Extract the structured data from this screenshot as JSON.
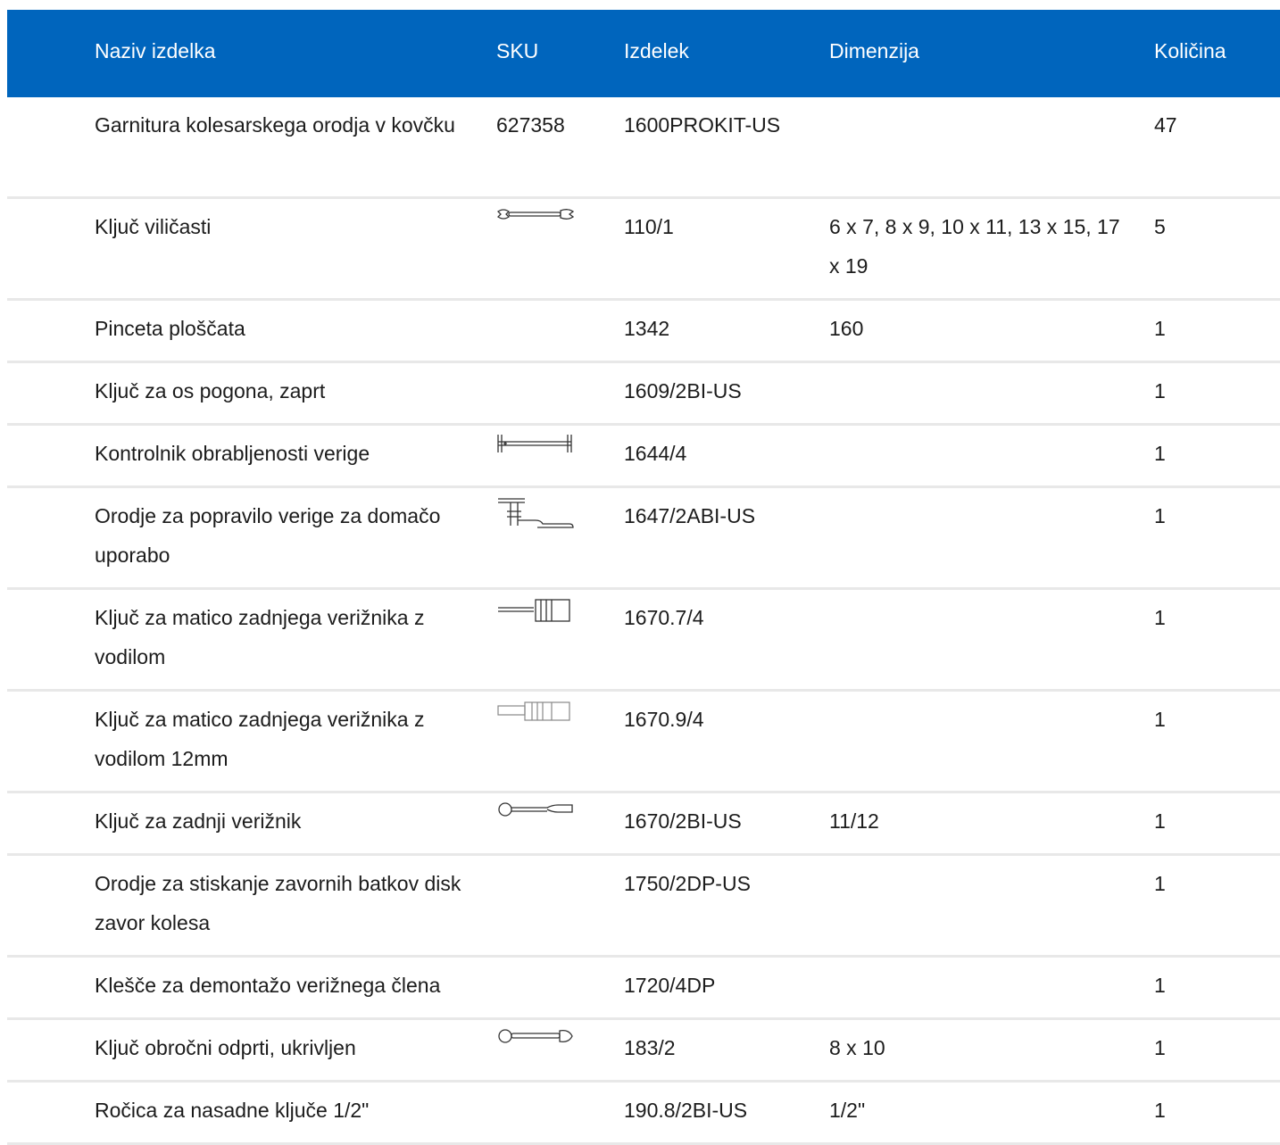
{
  "header": {
    "name": "Naziv izdelka",
    "sku": "SKU",
    "item": "Izdelek",
    "dimension": "Dimenzija",
    "quantity": "Količina"
  },
  "rows": [
    {
      "name": "Garnitura kolesarskega orodja v kovčku",
      "sku": "627358",
      "item": "1600PROKIT-US",
      "dimension": "",
      "quantity": "47",
      "icon": ""
    },
    {
      "name": "Ključ viličasti",
      "sku": "",
      "item": "110/1",
      "dimension": "6 x 7, 8 x 9, 10 x 11, 13 x 15, 17 x 19",
      "quantity": "5",
      "icon": "open-end-wrench-icon"
    },
    {
      "name": "Pinceta ploščata",
      "sku": "",
      "item": "1342",
      "dimension": "160",
      "quantity": "1",
      "icon": ""
    },
    {
      "name": "Ključ za os pogona, zaprt",
      "sku": "",
      "item": "1609/2BI-US",
      "dimension": "",
      "quantity": "1",
      "icon": ""
    },
    {
      "name": "Kontrolnik obrabljenosti verige",
      "sku": "",
      "item": "1644/4",
      "dimension": "",
      "quantity": "1",
      "icon": "chain-wear-gauge-icon"
    },
    {
      "name": "Orodje za popravilo verige za domačo uporabo",
      "sku": "",
      "item": "1647/2ABI-US",
      "dimension": "",
      "quantity": "1",
      "icon": "chain-tool-icon"
    },
    {
      "name": "Ključ za matico zadnjega verižnika z vodilom",
      "sku": "",
      "item": "1670.7/4",
      "dimension": "",
      "quantity": "1",
      "icon": "cassette-lockring-tool-icon"
    },
    {
      "name": "Ključ za matico zadnjega verižnika z vodilom 12mm",
      "sku": "",
      "item": "1670.9/4",
      "dimension": "",
      "quantity": "1",
      "icon": "cassette-lockring-tool-12mm-icon"
    },
    {
      "name": "Ključ za zadnji verižnik",
      "sku": "",
      "item": "1670/2BI-US",
      "dimension": "11/12",
      "quantity": "1",
      "icon": "chain-whip-icon"
    },
    {
      "name": "Orodje za stiskanje zavornih batkov disk zavor kolesa",
      "sku": "",
      "item": "1750/2DP-US",
      "dimension": "",
      "quantity": "1",
      "icon": ""
    },
    {
      "name": "Klešče za demontažo verižnega člena",
      "sku": "",
      "item": "1720/4DP",
      "dimension": "",
      "quantity": "1",
      "icon": ""
    },
    {
      "name": "Ključ obročni odprti, ukrivljen",
      "sku": "",
      "item": "183/2",
      "dimension": "8 x 10",
      "quantity": "1",
      "icon": "flare-nut-wrench-icon"
    },
    {
      "name": "Ročica za nasadne ključe 1/2\"",
      "sku": "",
      "item": "190.8/2BI-US",
      "dimension": "1/2\"",
      "quantity": "1",
      "icon": ""
    }
  ],
  "colors": {
    "header_bg": "#0065bd",
    "header_text": "#ffffff",
    "row_divider": "#e8e8e8"
  }
}
